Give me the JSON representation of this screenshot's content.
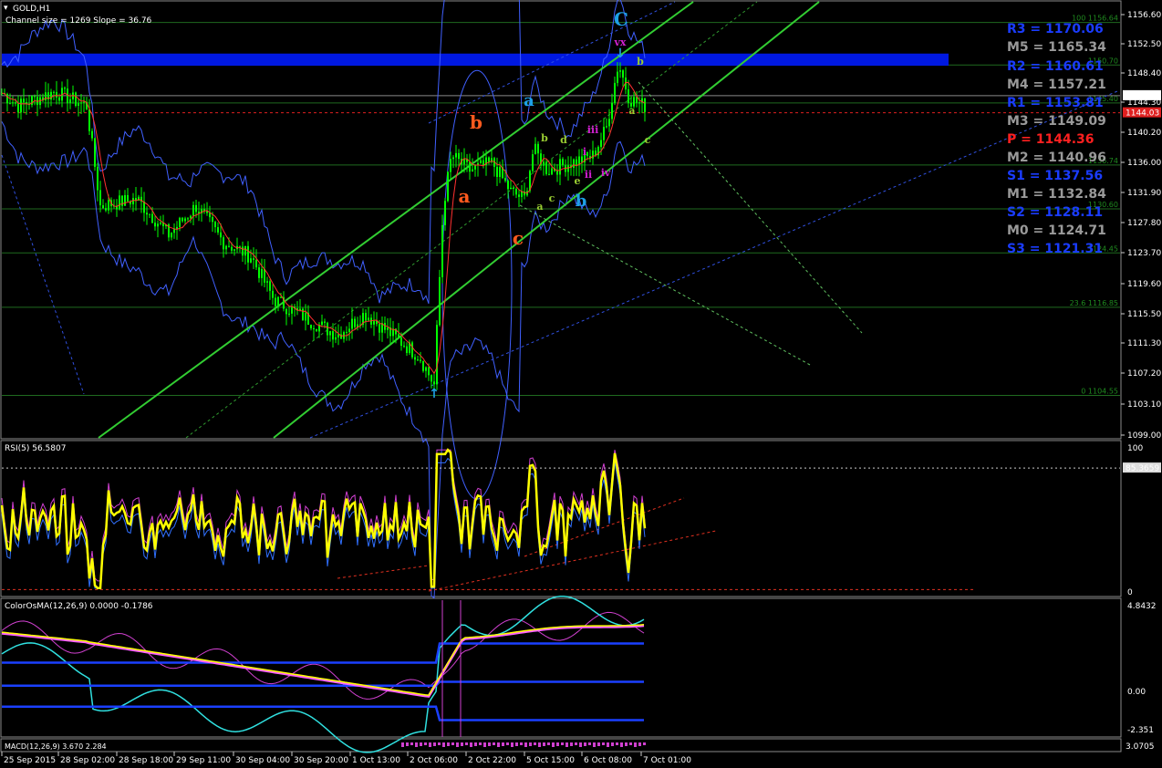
{
  "chart_data": {
    "type": "line",
    "symbol_label": "GOLD,H1",
    "channel_label": "Channel size = 1269 Slope = 36.76",
    "price_axis": [
      "1156.60",
      "1152.50",
      "1148.40",
      "1144.30",
      "1140.20",
      "1136.00",
      "1131.90",
      "1127.80",
      "1123.70",
      "1119.60",
      "1115.50",
      "1111.30",
      "1107.20",
      "1103.10",
      "1099.00"
    ],
    "price_range": [
      1099.0,
      1158.0
    ],
    "last_price": "1146.42",
    "ref_price": "1144.03",
    "x_axis": [
      "25 Sep 2015",
      "28 Sep 02:00",
      "28 Sep 18:00",
      "29 Sep 11:00",
      "30 Sep 04:00",
      "30 Sep 20:00",
      "1 Oct 13:00",
      "2 Oct 06:00",
      "2 Oct 22:00",
      "5 Oct 15:00",
      "6 Oct 08:00",
      "7 Oct 01:00"
    ],
    "pivots": [
      {
        "label": "R3 = 1170.06",
        "color": "#1a3cff"
      },
      {
        "label": "M5 = 1165.34",
        "color": "#9a9a9a"
      },
      {
        "label": "R2 = 1160.61",
        "color": "#1a3cff"
      },
      {
        "label": "M4 = 1157.21",
        "color": "#9a9a9a"
      },
      {
        "label": "R1 = 1153.81",
        "color": "#1a3cff"
      },
      {
        "label": "M3 = 1149.09",
        "color": "#9a9a9a"
      },
      {
        "label": "P = 1144.36",
        "color": "#ff2020"
      },
      {
        "label": "M2 = 1140.96",
        "color": "#9a9a9a"
      },
      {
        "label": "S1 = 1137.56",
        "color": "#1a3cff"
      },
      {
        "label": "M1 = 1132.84",
        "color": "#9a9a9a"
      },
      {
        "label": "S2 = 1128.11",
        "color": "#1a3cff"
      },
      {
        "label": "M0 = 1124.71",
        "color": "#9a9a9a"
      },
      {
        "label": "S3 = 1121.31",
        "color": "#1a3cff"
      }
    ],
    "fib_levels": [
      {
        "label": "100 1156.64",
        "value": 1156.64
      },
      {
        "label": "1150.70",
        "value": 1150.7
      },
      {
        "label": "1145.40",
        "value": 1145.4
      },
      {
        "label": "1136.74",
        "value": 1136.74
      },
      {
        "label": "1130.60",
        "value": 1130.6
      },
      {
        "label": "1124.45",
        "value": 1124.45
      },
      {
        "label": "23.6 1116.85",
        "value": 1116.85
      },
      {
        "label": "0 1104.55",
        "value": 1104.55
      }
    ],
    "wave_labels": [
      {
        "text": "C",
        "color": "#1ea0e6"
      },
      {
        "text": "vx",
        "color": "#d020d0"
      },
      {
        "text": "b",
        "color": "#ff5a1e"
      },
      {
        "text": "a",
        "color": "#ff5a1e"
      },
      {
        "text": "c",
        "color": "#ff5a1e"
      },
      {
        "text": "a",
        "color": "#1ea0e6"
      },
      {
        "text": "b",
        "color": "#1ea0e6"
      },
      {
        "text": "b",
        "color": "#9acd32"
      },
      {
        "text": "d",
        "color": "#9acd32"
      },
      {
        "text": "e",
        "color": "#9acd32"
      },
      {
        "text": "c",
        "color": "#9acd32"
      },
      {
        "text": "a",
        "color": "#9acd32"
      },
      {
        "text": "b",
        "color": "#9acd32"
      },
      {
        "text": "a",
        "color": "#9acd32"
      },
      {
        "text": "c",
        "color": "#9acd32"
      },
      {
        "text": "iii",
        "color": "#d020d0"
      },
      {
        "text": "i",
        "color": "#d020d0"
      },
      {
        "text": "ii",
        "color": "#d020d0"
      },
      {
        "text": "iv",
        "color": "#d020d0"
      }
    ],
    "rsi": {
      "label": "RSI(5) 56.5807",
      "axis": [
        "100",
        "0"
      ],
      "current": "85.3659"
    },
    "osma": {
      "label": "ColorOsMA(12,26,9) 0.0000 -0.1786",
      "axis": [
        "4.8432",
        "0.00",
        "-2.351"
      ]
    },
    "macd": {
      "label": "MACD(12,26,9) 3.670 2.284",
      "axis": "3.0705"
    },
    "colors": {
      "candle": "#00ff00",
      "channel": "#32cd32",
      "band": "#4060ff",
      "ma": "#ff3030",
      "rsi": "#ffff00",
      "resistance_zone": "#0018e0"
    }
  }
}
